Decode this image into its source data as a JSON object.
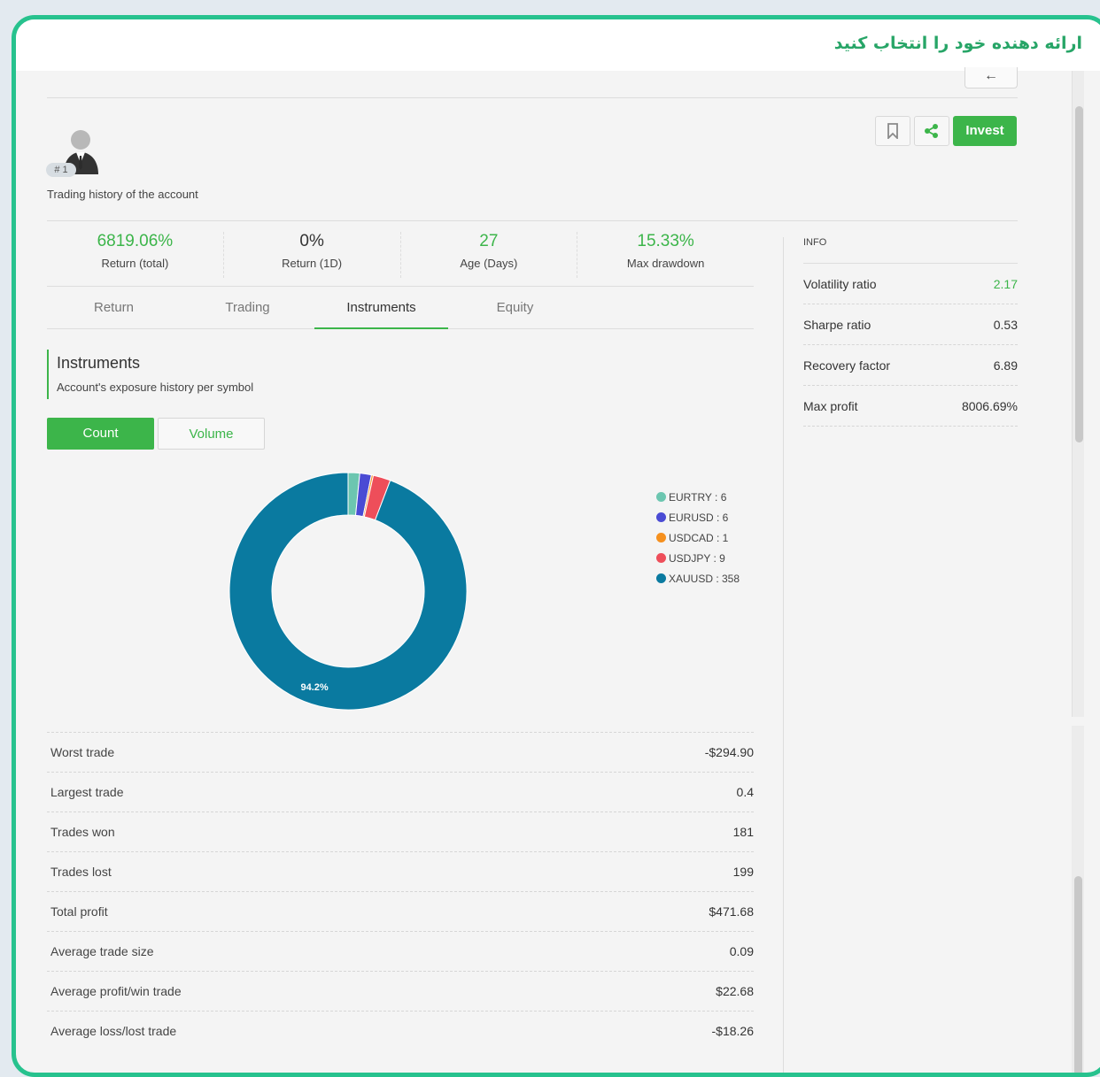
{
  "titlebar": {
    "text": "ارائه دهنده خود را انتخاب کنید"
  },
  "header": {
    "back_icon": "←",
    "rank_badge": "# 1",
    "account_label": "Trading history of the account",
    "invest_label": "Invest",
    "accent_color": "#3cb54a"
  },
  "stats": [
    {
      "value": "6819.06%",
      "label": "Return (total)",
      "highlight": true
    },
    {
      "value": "0%",
      "label": "Return (1D)",
      "highlight": false
    },
    {
      "value": "27",
      "label": "Age (Days)",
      "highlight": true
    },
    {
      "value": "15.33%",
      "label": "Max drawdown",
      "highlight": true
    }
  ],
  "tabs": [
    {
      "label": "Return",
      "active": false
    },
    {
      "label": "Trading",
      "active": false
    },
    {
      "label": "Instruments",
      "active": true
    },
    {
      "label": "Equity",
      "active": false
    }
  ],
  "section": {
    "title": "Instruments",
    "subtitle": "Account's exposure history per symbol",
    "toggle_count": "Count",
    "toggle_volume": "Volume"
  },
  "chart_data": {
    "type": "pie",
    "donut": true,
    "categories": [
      "EURTRY",
      "EURUSD",
      "USDCAD",
      "USDJPY",
      "XAUUSD"
    ],
    "values": [
      6,
      6,
      1,
      9,
      358
    ],
    "colors": [
      "#6cc6b0",
      "#4a4bd4",
      "#f5901e",
      "#ee4e5a",
      "#0a7aa0"
    ],
    "legend": [
      "EURTRY : 6",
      "EURUSD : 6",
      "USDCAD : 1",
      "USDJPY : 9",
      "XAUUSD : 358"
    ],
    "data_labels": [
      "94.2%"
    ],
    "legend_position": "right"
  },
  "info": {
    "heading": "INFO",
    "rows": [
      {
        "label": "Volatility ratio",
        "value": "2.17",
        "highlight": true
      },
      {
        "label": "Sharpe ratio",
        "value": "0.53",
        "highlight": false
      },
      {
        "label": "Recovery factor",
        "value": "6.89",
        "highlight": false
      },
      {
        "label": "Max profit",
        "value": "8006.69%",
        "highlight": false
      }
    ]
  },
  "metrics": [
    {
      "label": "Worst trade",
      "value": "-$294.90"
    },
    {
      "label": "Largest trade",
      "value": "0.4"
    },
    {
      "label": "Trades won",
      "value": "181"
    },
    {
      "label": "Trades lost",
      "value": "199"
    },
    {
      "label": "Total profit",
      "value": "$471.68"
    },
    {
      "label": "Average trade size",
      "value": "0.09"
    },
    {
      "label": "Average profit/win trade",
      "value": "$22.68"
    },
    {
      "label": "Average loss/lost trade",
      "value": "-$18.26"
    }
  ]
}
